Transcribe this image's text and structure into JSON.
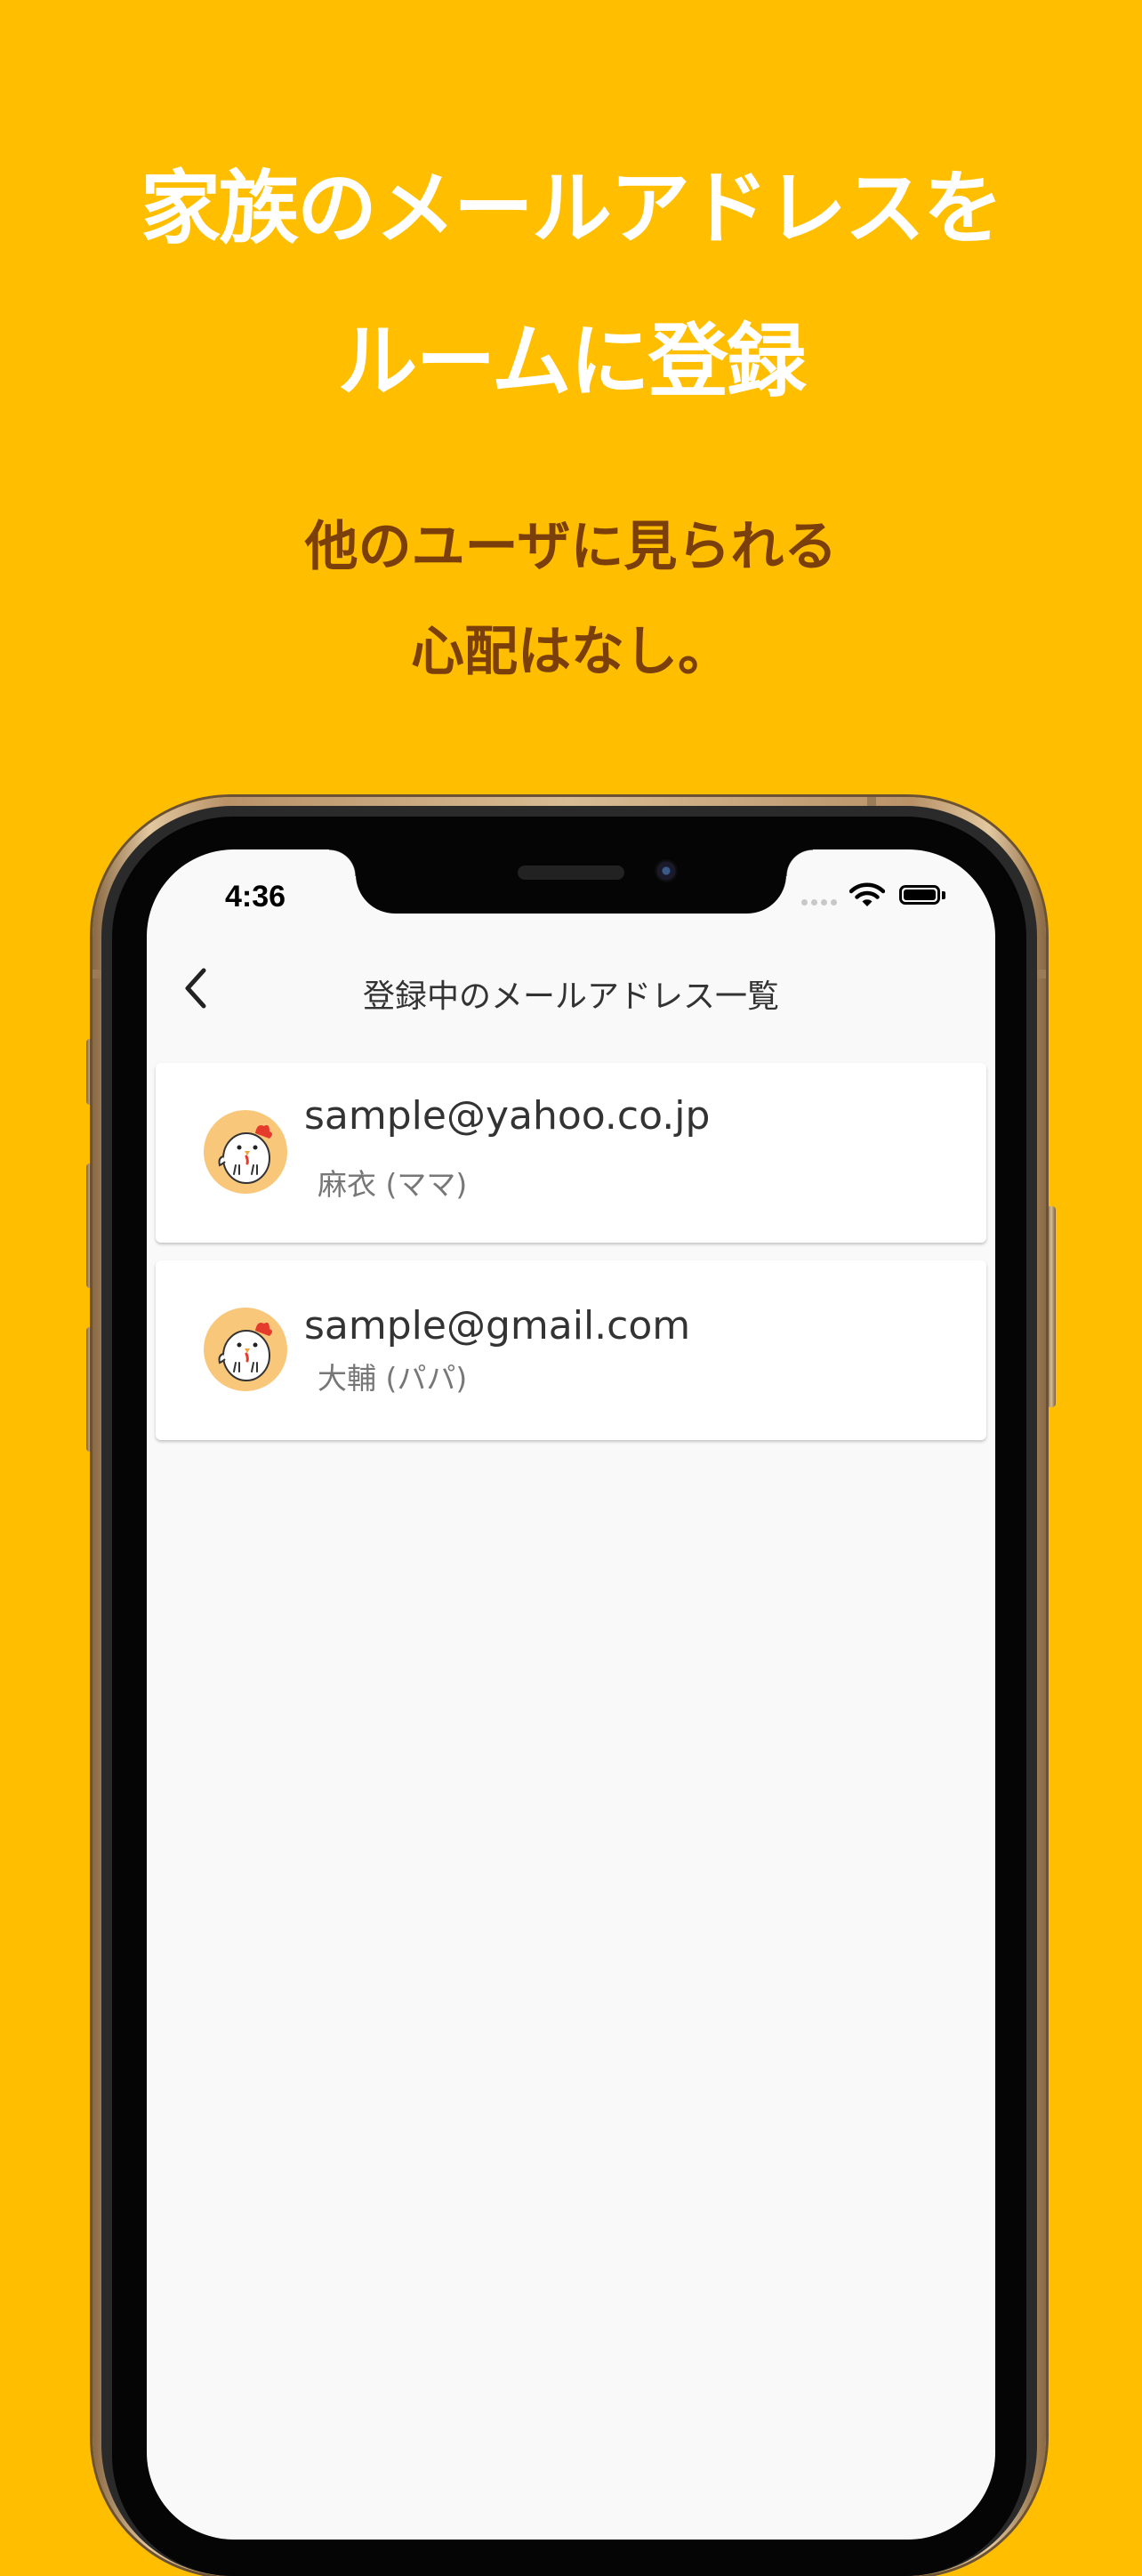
{
  "promo": {
    "headline_line1": "家族のメールアドレスを",
    "headline_line2": "ルームに登録",
    "subline_line1": "他のユーザに見られる",
    "subline_line2": "心配はなし。"
  },
  "status_bar": {
    "time": "4:36"
  },
  "nav": {
    "title": "登録中のメールアドレス一覧",
    "back_icon": "chevron-left-icon"
  },
  "members": [
    {
      "email": "sample@yahoo.co.jp",
      "name": "麻衣 (ママ)",
      "avatar_icon": "chicken-avatar-icon"
    },
    {
      "email": "sample@gmail.com",
      "name": "大輔 (パパ)",
      "avatar_icon": "chicken-avatar-icon"
    }
  ],
  "colors": {
    "background": "#ffbe00",
    "headline": "#ffffff",
    "subline": "#7a3f0a",
    "avatar_bg": "#f8c77a"
  }
}
